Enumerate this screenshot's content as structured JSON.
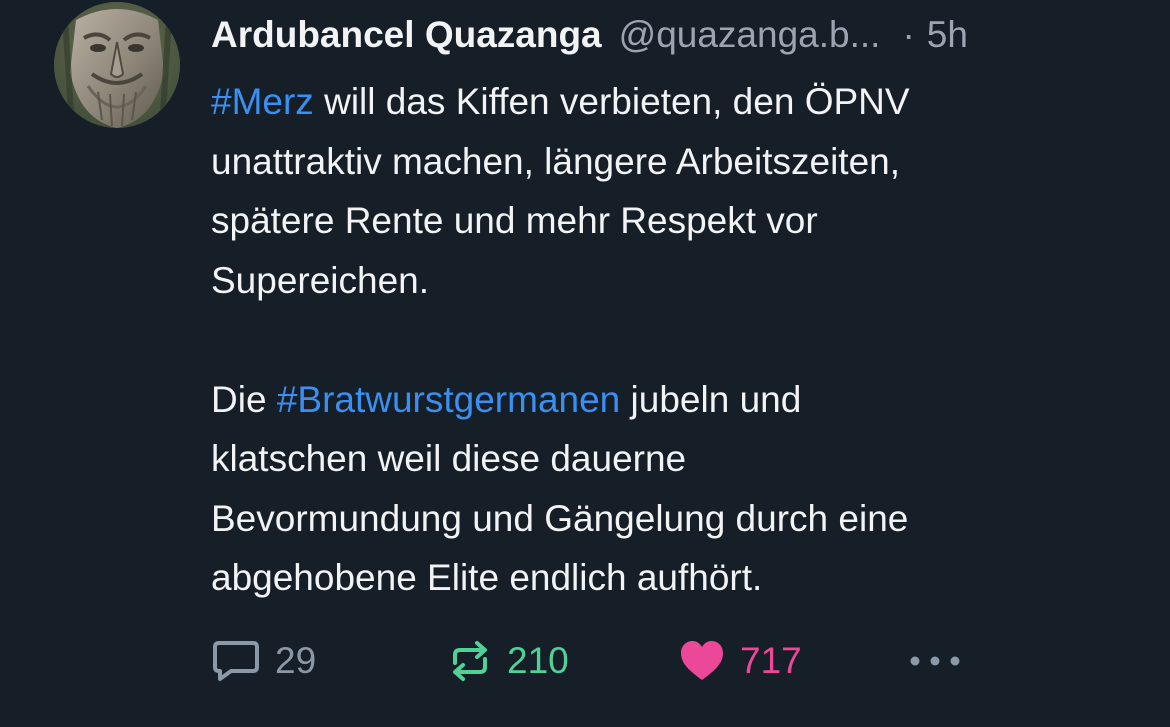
{
  "post": {
    "author": {
      "name": "Ardubancel Quazanga",
      "handle": "@quazanga.b...",
      "avatar": "carved-wooden-face-avatar"
    },
    "separator": "·",
    "timestamp": "5h",
    "text": {
      "paragraph1": {
        "lines": [
          {
            "hashtag": "#Merz",
            "rest": " will das Kiffen verbieten, den ÖPNV"
          },
          {
            "text": "unattraktiv machen, längere Arbeitszeiten,"
          },
          {
            "text": "spätere Rente und mehr Respekt vor"
          },
          {
            "text": "Supereichen."
          }
        ]
      },
      "paragraph2": {
        "lines": [
          {
            "prefix": "Die ",
            "hashtag": "#Bratwurstgermanen",
            "rest": " jubeln und"
          },
          {
            "text": "klatschen weil diese dauerne"
          },
          {
            "text": "Bevormundung und Gängelung durch eine"
          },
          {
            "text": "abgehobene Elite endlich aufhört."
          }
        ]
      }
    },
    "actions": {
      "reply": {
        "icon": "speech-bubble-icon",
        "count": "29"
      },
      "repost": {
        "icon": "repost-arrows-icon",
        "count": "210"
      },
      "like": {
        "icon": "heart-icon",
        "count": "717"
      },
      "more": {
        "icon": "more-dots-icon"
      }
    }
  },
  "colors": {
    "background": "#161e27",
    "text": "#f1f3f5",
    "muted": "#9aa5b1",
    "hashtag": "#3b8ff0",
    "repost": "#4fd197",
    "like": "#ec4899"
  }
}
